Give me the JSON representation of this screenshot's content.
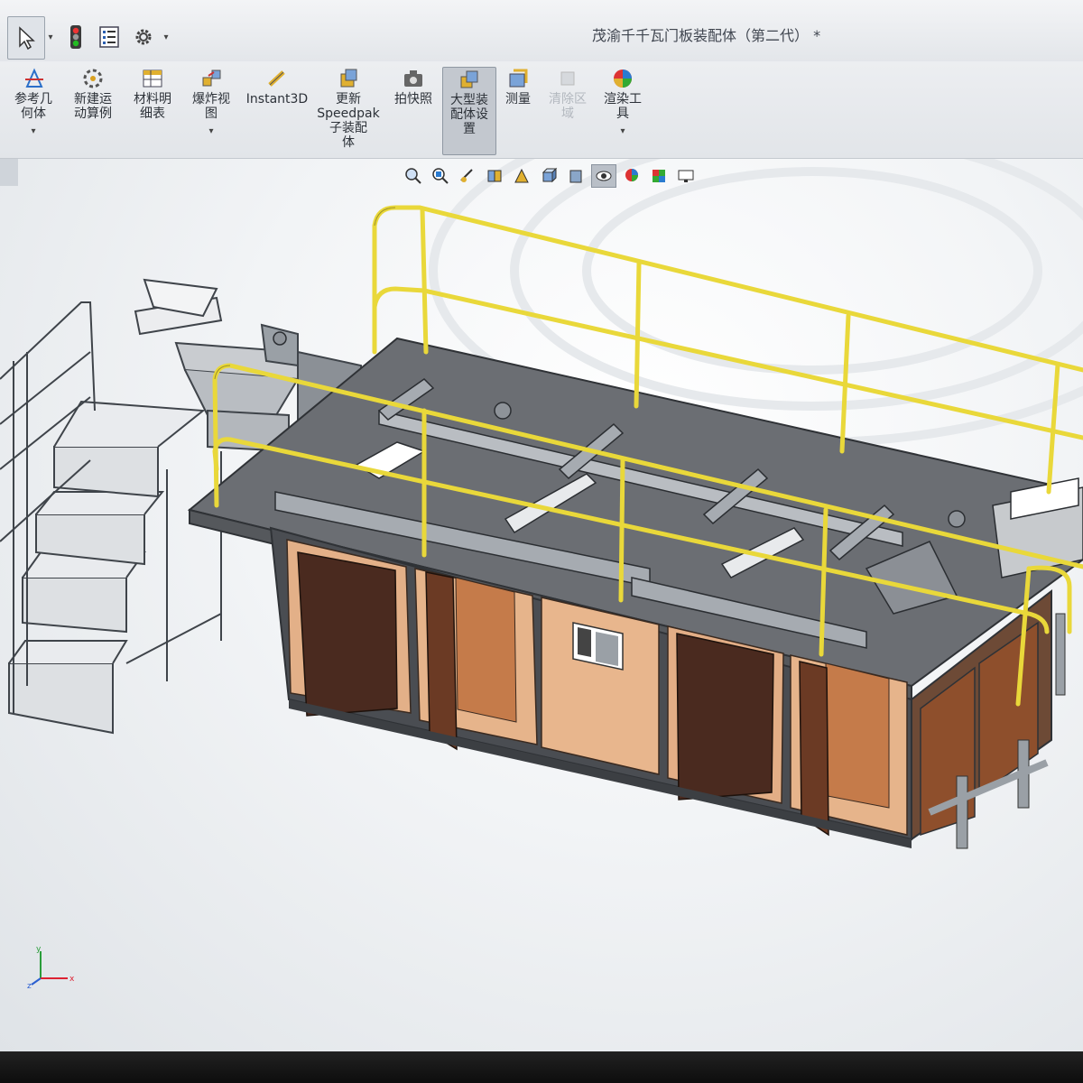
{
  "window": {
    "title": "茂渝千千瓦门板装配体（第二代） *"
  },
  "quick_access": {
    "icons": [
      "select-arrow-icon",
      "traffic-light-icon",
      "list-icon",
      "gear-icon"
    ]
  },
  "ribbon": {
    "items": [
      {
        "label": "参考几\n何体",
        "icon": "reference-geometry-icon"
      },
      {
        "label": "新建运\n动算例",
        "icon": "motion-study-icon"
      },
      {
        "label": "材料明\n细表",
        "icon": "bom-icon"
      },
      {
        "label": "爆炸视\n图",
        "icon": "exploded-view-icon"
      },
      {
        "label": "Instant3D",
        "icon": "instant3d-icon"
      },
      {
        "label": "更新\nSpeedpak\n子装配\n体",
        "icon": "speedpak-icon"
      },
      {
        "label": "拍快照",
        "icon": "camera-icon"
      },
      {
        "label": "大型装\n配体设\n置",
        "icon": "large-assembly-icon"
      },
      {
        "label": "测量",
        "icon": "measure-icon"
      },
      {
        "label": "清除区\n域",
        "icon": "clear-area-icon"
      },
      {
        "label": "渲染工\n具",
        "icon": "render-tools-icon"
      }
    ]
  },
  "heads_up_view": {
    "icons": [
      "zoom-to-fit-icon",
      "zoom-area-icon",
      "previous-view-icon",
      "section-view-icon",
      "dynamic-annotation-icon",
      "view-orientation-icon",
      "display-style-icon",
      "hide-show-icon",
      "edit-appearance-icon",
      "apply-scene-icon",
      "view-settings-icon"
    ]
  },
  "triad": {
    "x": "x",
    "y": "y",
    "z": "z"
  },
  "colors": {
    "railing": "#e9d83a",
    "platform": "#6a6d72",
    "panel": "#e8b48a",
    "door": "#4a2a1f",
    "frame": "#9aa0a6"
  }
}
